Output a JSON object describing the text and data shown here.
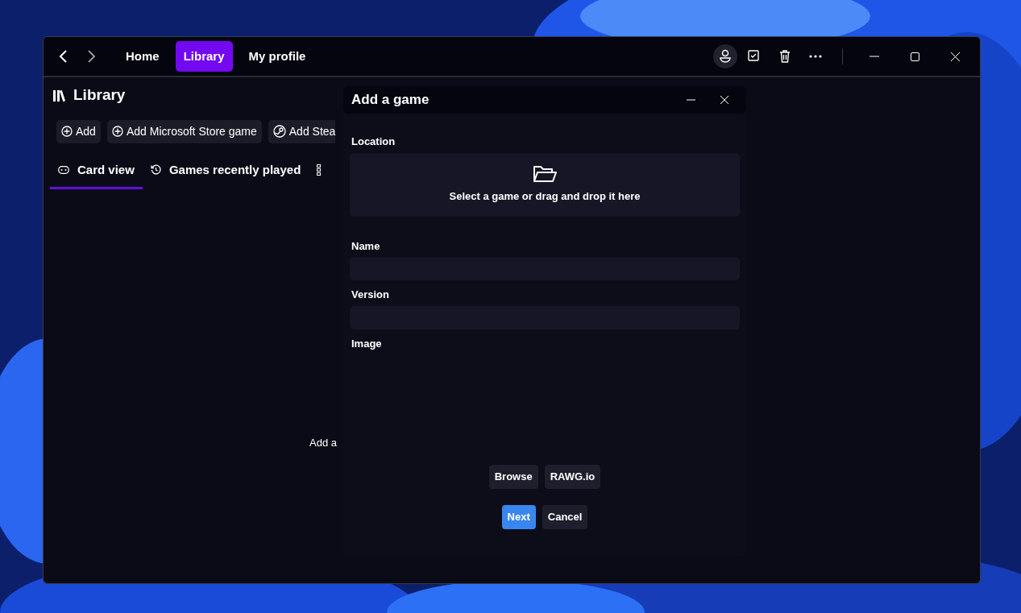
{
  "nav": [
    {
      "label": "Home",
      "selected": false
    },
    {
      "label": "Library",
      "selected": true
    },
    {
      "label": "My profile",
      "selected": false
    }
  ],
  "page": {
    "title": "Library",
    "actions": [
      {
        "label": "Add",
        "kind": "plus"
      },
      {
        "label": "Add Microsoft Store game",
        "kind": "plus"
      },
      {
        "label": "Add Stea",
        "kind": "steam"
      }
    ],
    "tabs": [
      {
        "label": "Card view",
        "kind": "card",
        "selected": true
      },
      {
        "label": "Games recently played",
        "kind": "history",
        "selected": false
      },
      {
        "kind": "grid",
        "selected": false
      }
    ],
    "empty_text": "Add a"
  },
  "dialog": {
    "title": "Add a game",
    "location_label": "Location",
    "dropzone_text": "Select a game or drag and drop it here",
    "fields": [
      {
        "label": "Name"
      },
      {
        "label": "Version"
      }
    ],
    "image_label": "Image",
    "image_buttons": [
      "Browse",
      "RAWG.io"
    ],
    "buttons": [
      {
        "label": "Next",
        "kind": "primary"
      },
      {
        "label": "Cancel",
        "kind": "secondary"
      }
    ]
  }
}
